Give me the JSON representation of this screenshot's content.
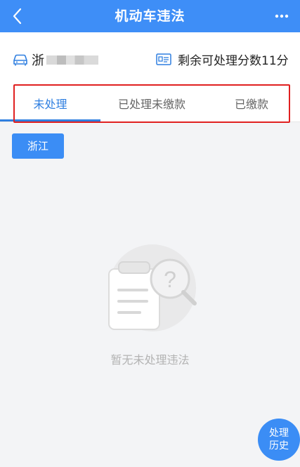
{
  "navbar": {
    "title": "机动车违法",
    "back_icon": "chevron-left-icon",
    "more_icon": "more-dots-icon",
    "color": "#3e8ef7"
  },
  "info": {
    "car_icon": "car-icon",
    "plate_prefix": "浙",
    "id_icon": "id-card-icon",
    "points_text": "剩余可处理分数11分"
  },
  "tabs": [
    {
      "label": "未处理",
      "active": true
    },
    {
      "label": "已处理未缴款",
      "active": false
    },
    {
      "label": "已缴款",
      "active": false
    }
  ],
  "tab_active_color": "#2f7fe0",
  "region_chip": {
    "label": "浙江"
  },
  "empty_state": {
    "icon": "clipboard-question-icon",
    "text": "暂无未处理违法"
  },
  "history_button": {
    "line1": "处理",
    "line2": "历史"
  }
}
